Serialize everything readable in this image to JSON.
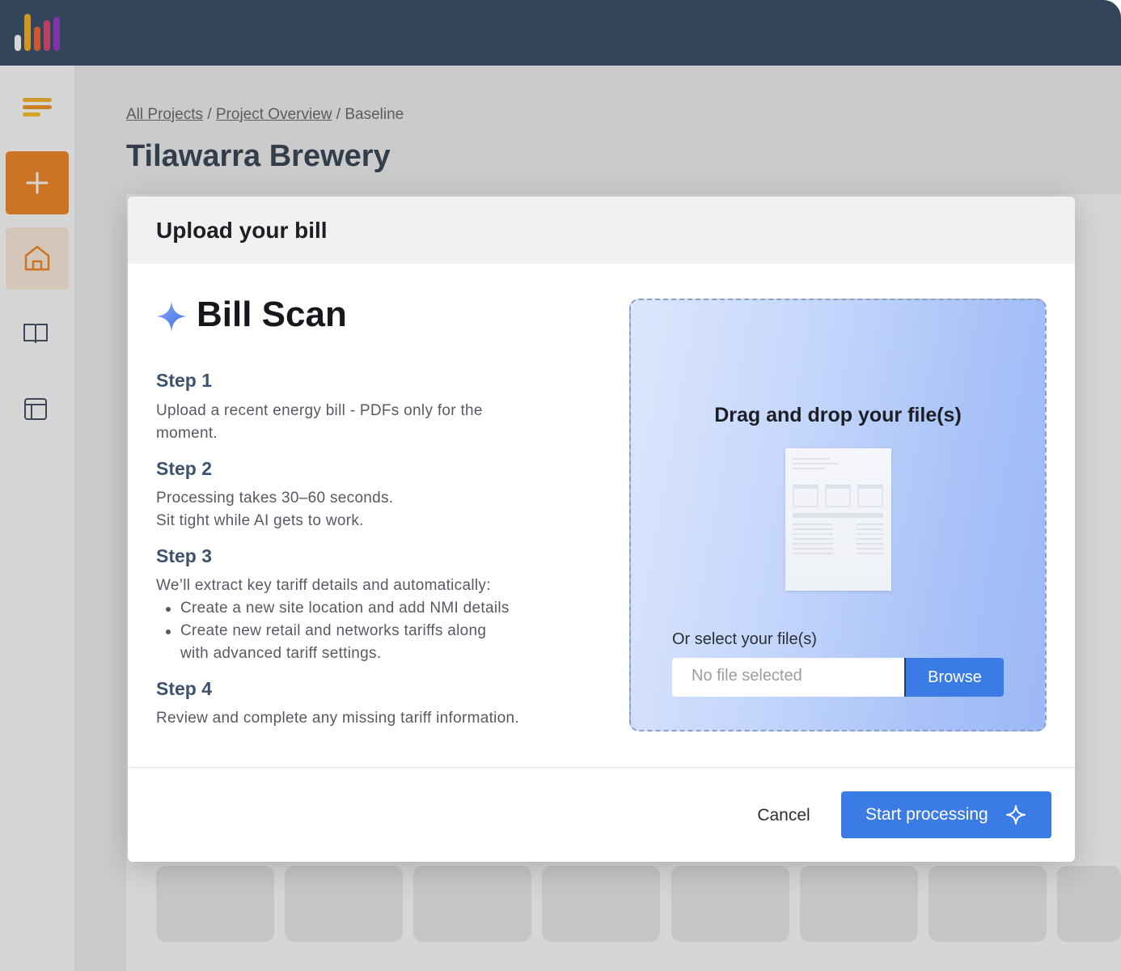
{
  "app": {
    "logo_icon": "bar-chart-logo",
    "colors": {
      "topbar": "#3d536d",
      "accent": "#f58a2b",
      "primary": "#3b7be6"
    }
  },
  "sidebar": {
    "items": [
      {
        "icon": "menu-icon"
      },
      {
        "icon": "plus-icon",
        "action": "add"
      },
      {
        "icon": "home-icon",
        "active": true
      },
      {
        "icon": "book-icon"
      },
      {
        "icon": "layout-icon"
      }
    ]
  },
  "page": {
    "breadcrumb": {
      "all_projects": "All Projects",
      "sep1": "/",
      "project_overview": "Project Overview",
      "sep2": "/",
      "current": "Baseline"
    },
    "title": "Tilawarra Brewery"
  },
  "modal": {
    "title": "Upload your bill",
    "brand": {
      "icon": "sparkle-icon",
      "name": "Bill Scan"
    },
    "steps": [
      {
        "heading": "Step 1",
        "line1": "Upload a recent energy bill - PDFs only for the",
        "line2": "moment."
      },
      {
        "heading": "Step 2",
        "line1": "Processing takes 30–60 seconds.",
        "line2": "Sit tight while AI gets to work."
      },
      {
        "heading": "Step 3",
        "line1": "We’ll extract key tariff details and automatically:",
        "bullets": [
          {
            "line1": "Create a new site location and add NMI details"
          },
          {
            "line1": "Create new retail and networks tariffs along",
            "line2": "with advanced tariff settings."
          }
        ]
      },
      {
        "heading": "Step 4",
        "line1": "Review and complete any missing tariff information."
      }
    ],
    "dropzone": {
      "title": "Drag and drop your file(s)",
      "select_label": "Or select your file(s)",
      "file_placeholder": "No file selected",
      "browse_label": "Browse"
    },
    "footer": {
      "cancel_label": "Cancel",
      "start_label": "Start processing"
    }
  }
}
